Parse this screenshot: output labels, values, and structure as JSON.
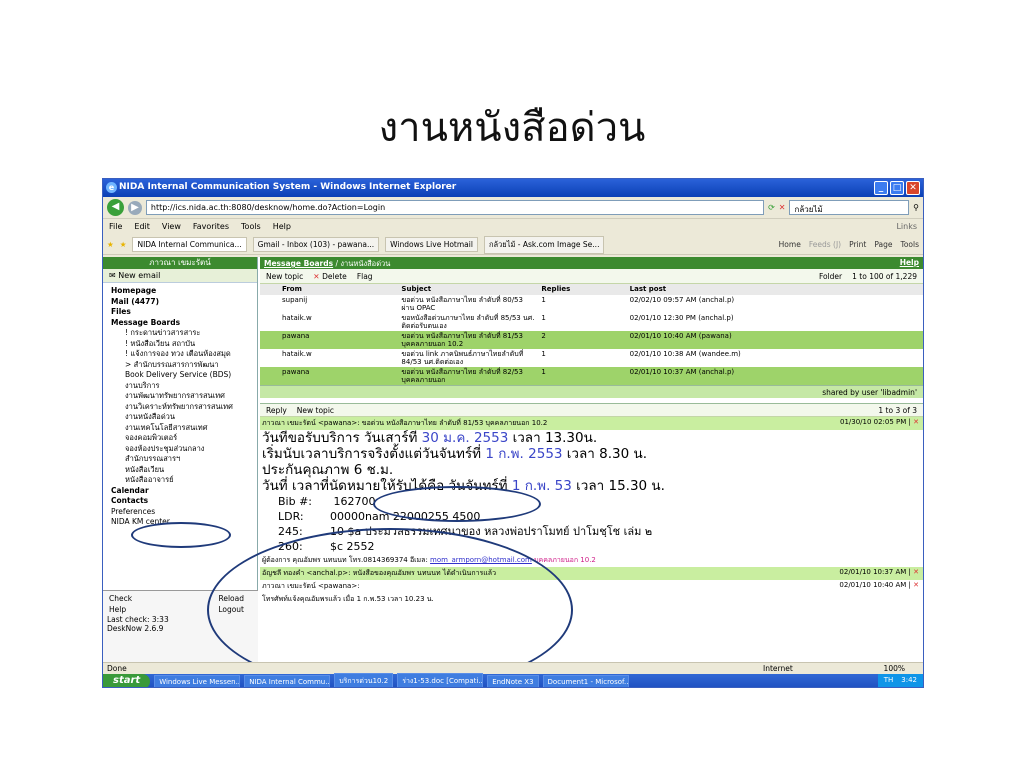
{
  "slide": {
    "title": "งานหนังสือด่วน"
  },
  "window": {
    "title": "NIDA Internal Communication System - Windows Internet Explorer",
    "url": "http://ics.nida.ac.th:8080/desknow/home.do?Action=Login",
    "search_value": "กล้วยไม้",
    "menu": [
      "File",
      "Edit",
      "View",
      "Favorites",
      "Tools",
      "Help"
    ],
    "links": "Links",
    "tabs": [
      "NIDA Internal Communica...",
      "Gmail - Inbox (103) - pawana...",
      "Windows Live Hotmail",
      "กล้วยไม้ - Ask.com Image Se..."
    ],
    "tab_tools": [
      "Home",
      "Feeds (J)",
      "Print",
      "Page",
      "Tools"
    ]
  },
  "left": {
    "user": "ภาวณา เขมะรัตน์",
    "new_email": "New email",
    "tree": [
      "Homepage",
      "Mail (4477)",
      "Files",
      "Message Boards",
      "! กระดานข่าวสารสาระ",
      "! หนังสือเวียน สถาบัน",
      "! แจ้งการจอง ทวง เตือนห้องสมุด",
      "> สำนักบรรณสารการพัฒนา",
      "Book Delivery Service (BDS)",
      "งานบริการ",
      "งานพัฒนาทรัพยากรสารสนเทศ",
      "งานวิเคราะห์ทรัพยากรสารสนเทศ",
      "งานหนังสือด่วน",
      "งานเทคโนโลยีสารสนเทศ",
      "จองคอมพิวเตอร์",
      "จองห้องประชุมส่วนกลาง",
      "สำนักบรรณสารฯ",
      "หนังสือเวียน",
      "หนังสืออาจารย์",
      "Calendar",
      "Contacts",
      "Preferences",
      "NIDA KM center"
    ],
    "bottom": {
      "check": "Check",
      "reload": "Reload",
      "help": "Help",
      "logout": "Logout",
      "last_check": "Last check: 3:33",
      "version": "DeskNow 2.6.9"
    }
  },
  "board": {
    "breadcrumb_link": "Message Boards",
    "breadcrumb_rest": " / งานหนังสือด่วน",
    "help": "Help",
    "new_topic": "New topic",
    "delete": "Delete",
    "flag": "Flag",
    "folder": "Folder",
    "range": "1 to 100 of 1,229",
    "columns": {
      "from": "From",
      "subject": "Subject",
      "replies": "Replies",
      "last_post": "Last post"
    },
    "rows": [
      {
        "from": "supanij",
        "subject": "ขอด่วน หนังสือภาษาไทย ลำดับที่ 80/53 ผ่าน OPAC",
        "replies": "1",
        "last": "02/02/10 09:57 AM (anchal.p)"
      },
      {
        "from": "hataik.w",
        "subject": "ขอหนังสือด่วนภาษาไทย ลำดับที่ 85/53 นศ. ติดต่อรับตนเอง",
        "replies": "1",
        "last": "02/01/10 12:30 PM (anchal.p)"
      },
      {
        "from": "pawana",
        "subject": "ขอด่วน หนังสือภาษาไทย ลำดับที่ 81/53 บุคคลภายนอก 10.2",
        "replies": "2",
        "last": "02/01/10 10:40 AM (pawana)"
      },
      {
        "from": "hataik.w",
        "subject": "ขอด่วน link ภาคนิพนธ์ภาษาไทยลำดับที่ 84/53 นศ.ติดต่อเอง",
        "replies": "1",
        "last": "02/01/10 10:38 AM (wandee.m)"
      },
      {
        "from": "pawana",
        "subject": "ขอด่วน หนังสือภาษาไทย ลำดับที่ 82/53 บุคคลภายนอก",
        "replies": "1",
        "last": "02/01/10 10:37 AM (anchal.p)"
      }
    ],
    "shared": "shared by user 'libadmin'",
    "reply": "Reply",
    "new_topic2": "New topic",
    "range2": "1 to 3 of 3"
  },
  "thread": {
    "post1_header": "ภาวณา เขมะรัตน์ <pawana>: ขอด่วน หนังสือภาษาไทย ลำดับที่ 81/53 บุคคลภายนอก 10.2",
    "post1_date": "01/30/10 02:05 PM |",
    "lines": [
      {
        "a": "วันที่ขอรับบริการ วันเสาร์ที่ ",
        "b": "30 ม.ค. 2553",
        "c": " เวลา 13.30น."
      },
      {
        "a": "เริ่มนับเวลาบริการจริงตั้งแต่วันจันทร์ที่ ",
        "b": "1 ก.พ. 2553",
        "c": " เวลา 8.30 น."
      },
      {
        "a": "ประกันคุณภาพ 6  ช.ม.",
        "b": "",
        "c": ""
      },
      {
        "a": "วันที่ เวลาที่นัดหมายให้รับได้คือ วันจันทร์ที่ ",
        "b": "1 ก.พ. 53",
        "c": " เวลา 15.30 น."
      }
    ],
    "bib": [
      {
        "k": "Bib #:",
        "v": " 162700"
      },
      {
        "k": "LDR:",
        "v": "00000nam 22000255 4500"
      },
      {
        "k": "245:",
        "v": "10 $a ประมวลธรรมเทศนาของ หลวงพ่อปราโมทย์ ปาโมชฺโช เล่ม ๒"
      },
      {
        "k": "260:",
        "v": "$c 2552"
      }
    ],
    "contact": "ผู้ต้องการ คุณอัมพร นทนนท โทร.0814369374 อีเมล: ",
    "email": "mom_armporn@hotmail.com",
    "contact_tail": " บุคคลภายนอก 10.2",
    "post2_header": "อัญชลี ทองคำ <anchal.p>: หนังสือของคุณอัมพร นทนนท ได้ดำเนินการแล้ว",
    "post2_date": "02/01/10 10:37 AM |",
    "post3_header": "ภาวณา เขมะรัตน์ <pawana>:",
    "post3_date": "02/01/10 10:40 AM |",
    "post3_body": "โทรศัพท์แจ้งคุณอัมพรแล้ว เมื่อ 1 ก.พ.53 เวลา 10.23 น."
  },
  "status": {
    "done": "Done",
    "zone": "Internet",
    "zoom": "100%"
  },
  "taskbar": {
    "start": "start",
    "tasks": [
      "Windows Live Messen...",
      "NIDA Internal Commu...",
      "บริการด่วน10.2",
      "ร่าง1-53.doc [Compati...",
      "EndNote X3",
      "Document1 - Microsof..."
    ],
    "lang": "TH",
    "time": "3:42"
  }
}
